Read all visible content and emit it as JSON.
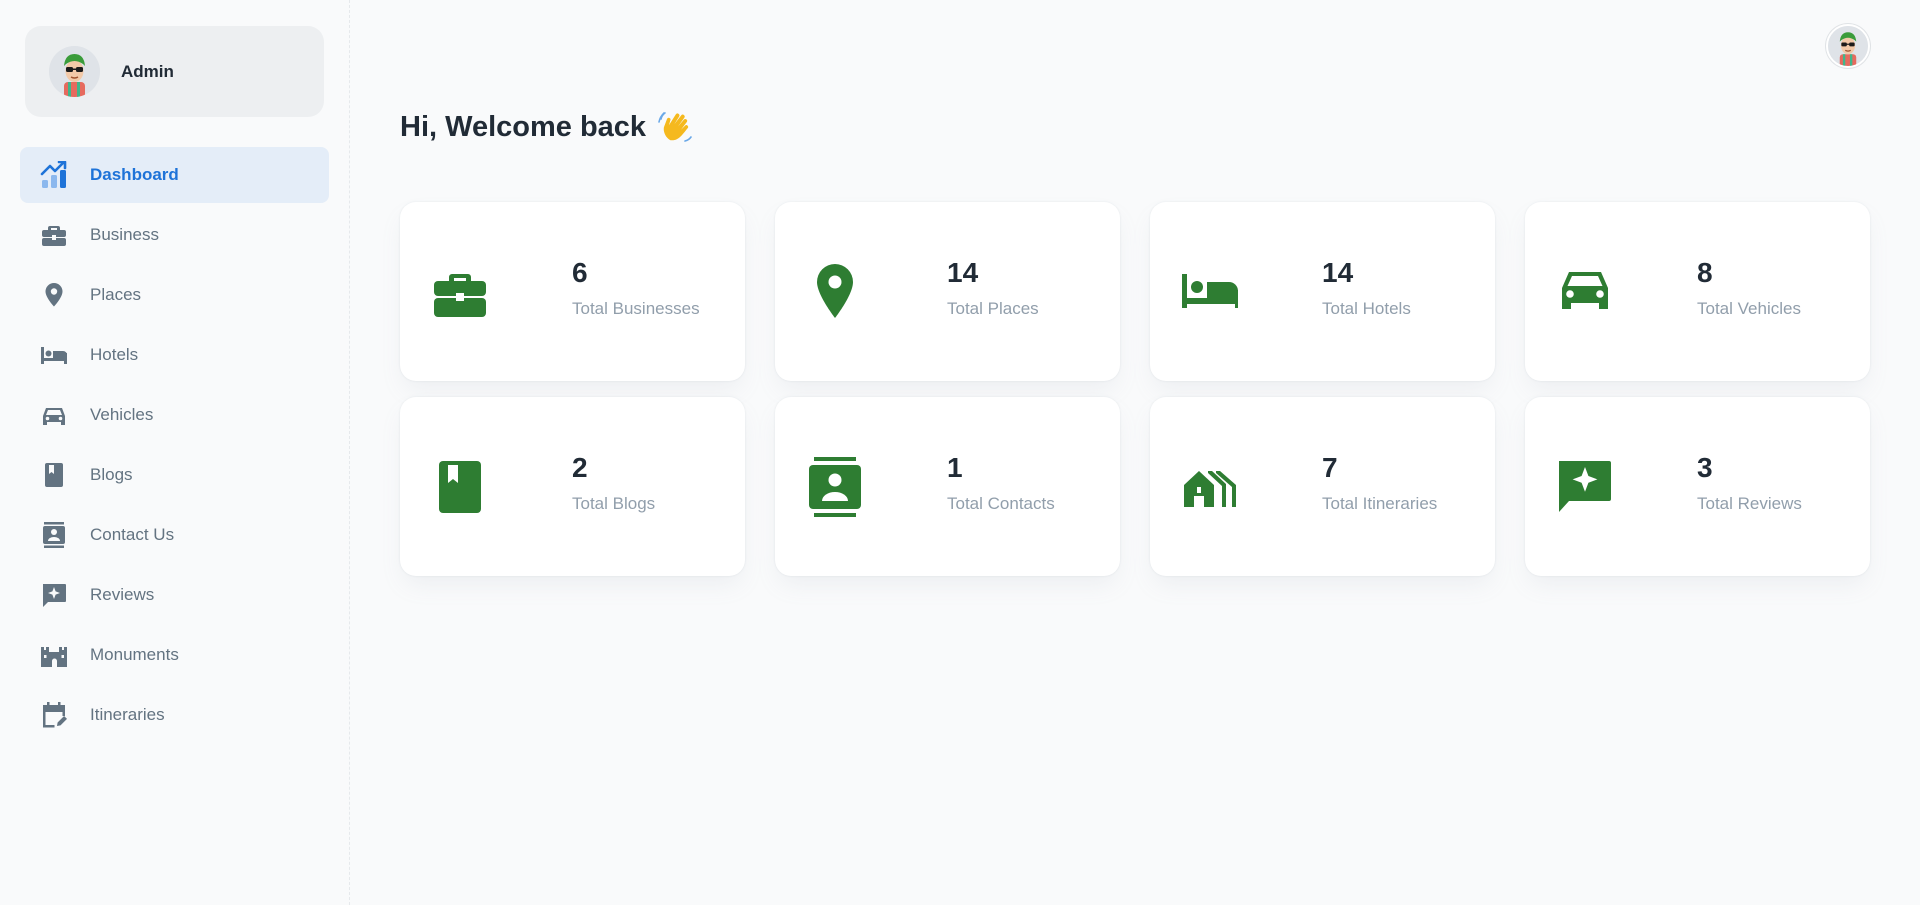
{
  "account": {
    "name": "Admin"
  },
  "sidebar": {
    "items": [
      {
        "label": "Dashboard",
        "icon": "dashboard-chart-icon",
        "active": true
      },
      {
        "label": "Business",
        "icon": "briefcase-icon"
      },
      {
        "label": "Places",
        "icon": "map-pin-icon"
      },
      {
        "label": "Hotels",
        "icon": "bed-icon"
      },
      {
        "label": "Vehicles",
        "icon": "car-icon"
      },
      {
        "label": "Blogs",
        "icon": "book-icon"
      },
      {
        "label": "Contact Us",
        "icon": "contact-card-icon"
      },
      {
        "label": "Reviews",
        "icon": "review-chat-icon"
      },
      {
        "label": "Monuments",
        "icon": "castle-icon"
      },
      {
        "label": "Itineraries",
        "icon": "calendar-edit-icon"
      }
    ]
  },
  "main": {
    "greeting": "Hi, Welcome back",
    "greeting_emoji": "waving-hand-icon"
  },
  "stats": [
    {
      "value": "6",
      "label": "Total Businesses",
      "icon": "briefcase-icon"
    },
    {
      "value": "14",
      "label": "Total Places",
      "icon": "map-pin-icon"
    },
    {
      "value": "14",
      "label": "Total Hotels",
      "icon": "bed-icon"
    },
    {
      "value": "8",
      "label": "Total Vehicles",
      "icon": "car-icon"
    },
    {
      "value": "2",
      "label": "Total Blogs",
      "icon": "book-icon"
    },
    {
      "value": "1",
      "label": "Total Contacts",
      "icon": "contact-card-icon"
    },
    {
      "value": "7",
      "label": "Total Itineraries",
      "icon": "houses-icon"
    },
    {
      "value": "3",
      "label": "Total Reviews",
      "icon": "review-chat-icon"
    }
  ],
  "colors": {
    "accent": "#1e73d8",
    "active_bg": "#e4edf8",
    "stat_icon": "#2e7d32",
    "nav_text": "#637381",
    "muted_text": "#919eab"
  }
}
